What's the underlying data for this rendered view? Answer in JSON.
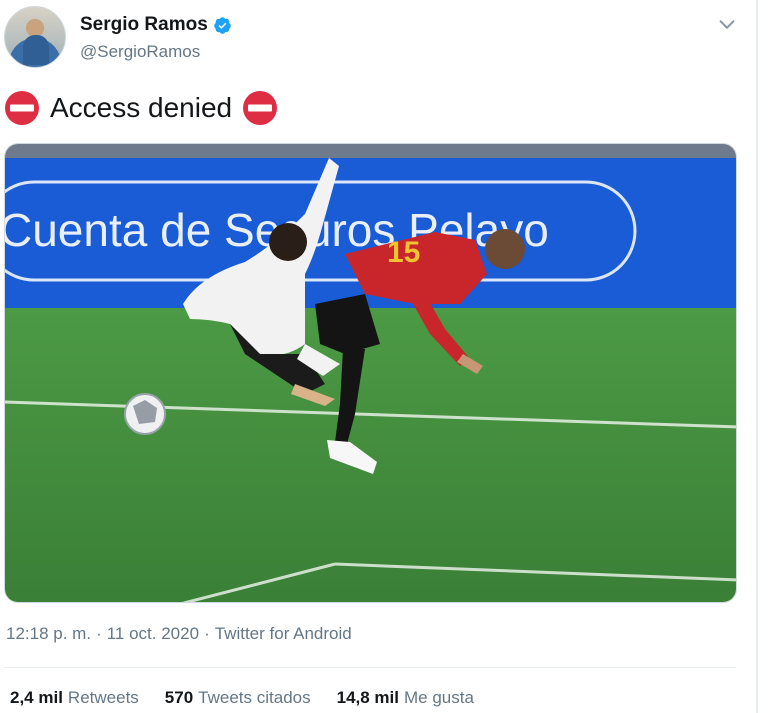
{
  "author": {
    "display_name": "Sergio Ramos",
    "handle": "@SergioRamos",
    "verified": true
  },
  "tweet": {
    "text": "Access denied",
    "emoji": "no-entry-icon"
  },
  "media": {
    "type": "video-still",
    "banner_text": "Cuenta de Seguros Pelayo"
  },
  "meta": {
    "time": "12:18 p. m.",
    "separator": "·",
    "date": "11 oct. 2020",
    "source": "Twitter for Android"
  },
  "stats": [
    {
      "value": "2,4 mil",
      "label": "Retweets"
    },
    {
      "value": "570",
      "label": "Tweets citados"
    },
    {
      "value": "14,8 mil",
      "label": "Me gusta"
    }
  ],
  "colors": {
    "verified": "#1da1f2",
    "no_entry": "#dd2e44",
    "muted_text": "#657786",
    "pitch": "#3f8a3a",
    "ad_board": "#1a5bd6"
  }
}
